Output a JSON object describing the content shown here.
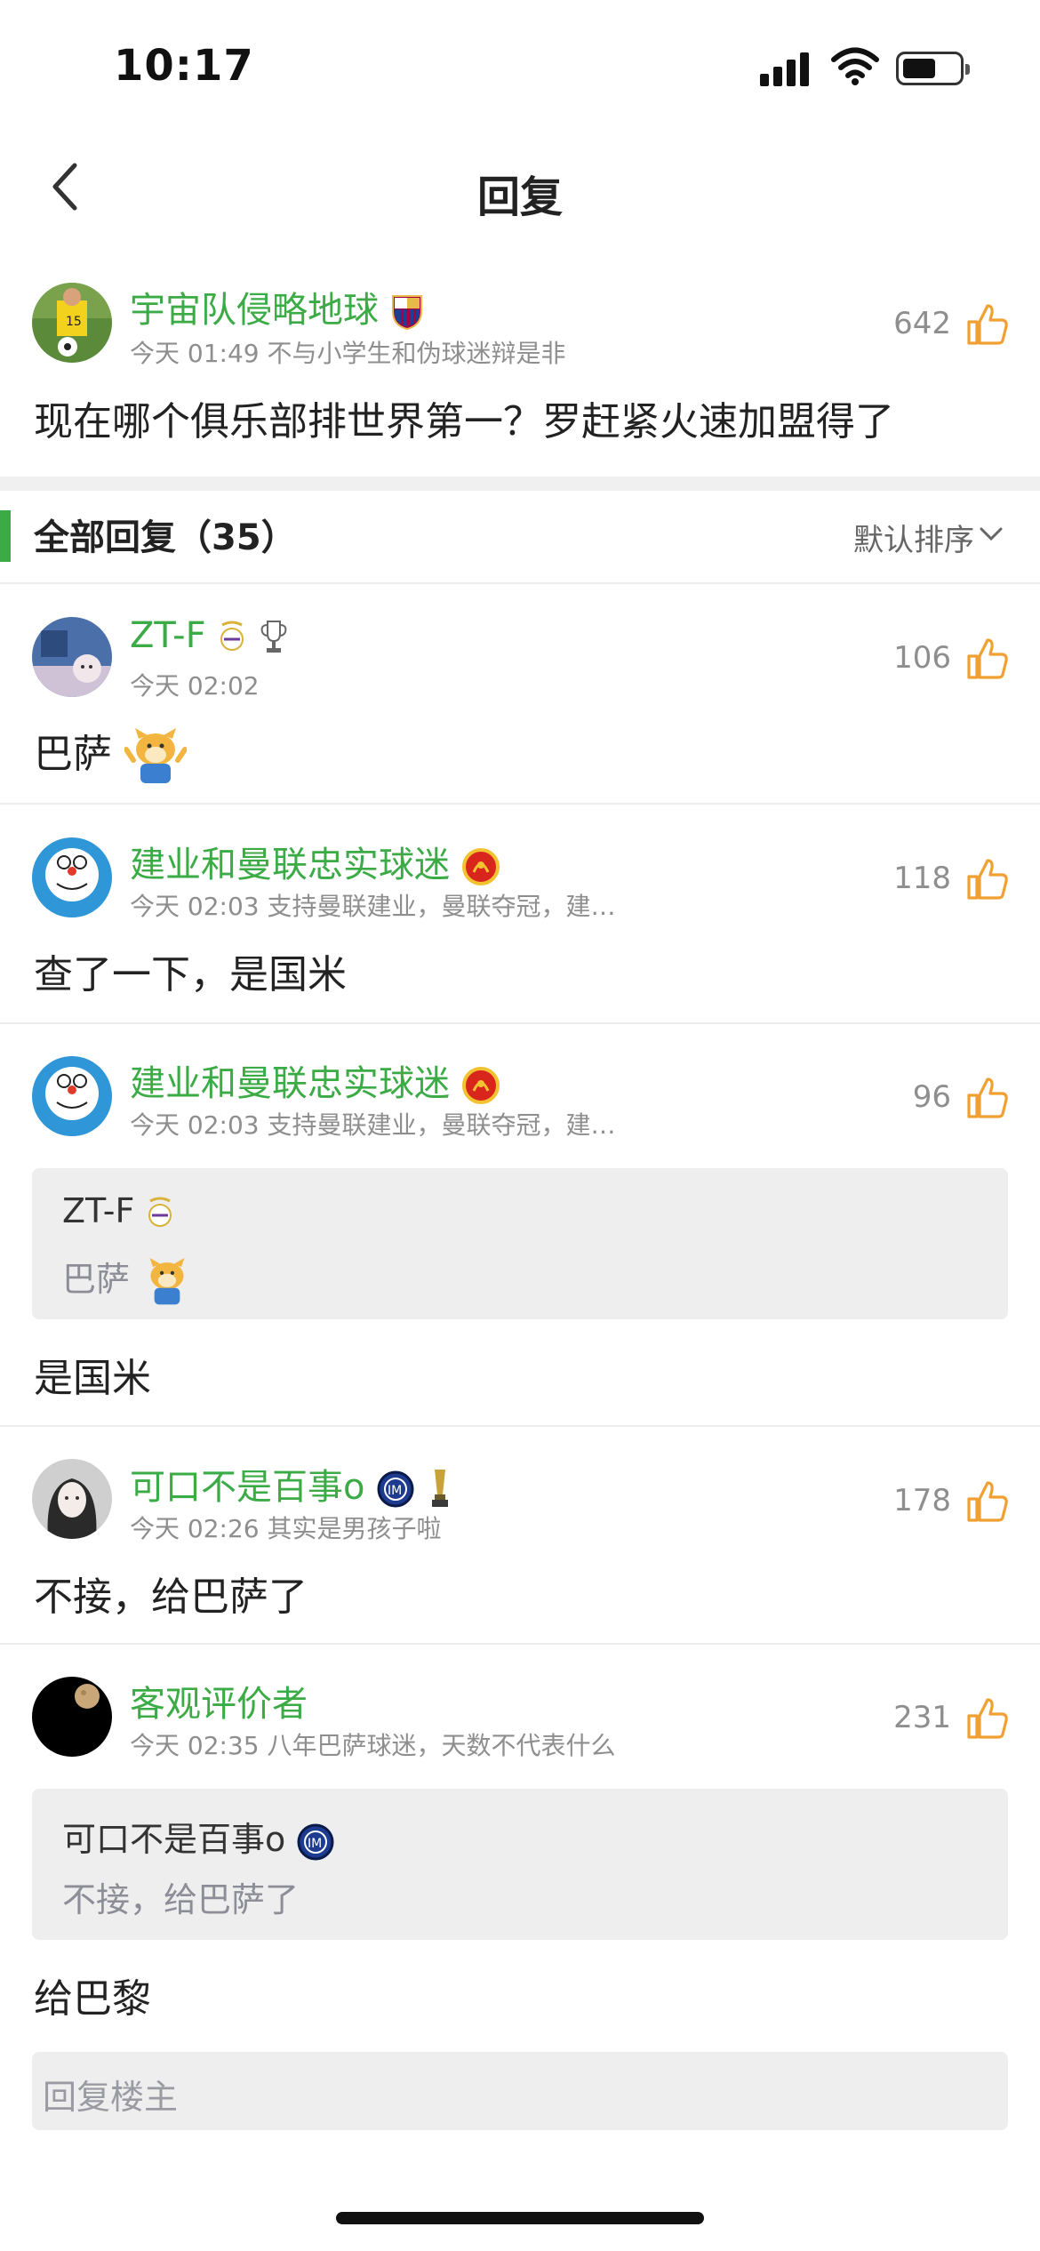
{
  "status": {
    "time": "10:17"
  },
  "nav": {
    "title": "回复",
    "back_icon": "chevron-left-icon"
  },
  "main_post": {
    "username": "宇宙队侵略地球",
    "meta": "今天 01:49 不与小学生和伪球迷辩是非",
    "likes": "642",
    "text": "现在哪个俱乐部排世界第一？罗赶紧火速加盟得了"
  },
  "section": {
    "title": "全部回复（35）",
    "sort_label": "默认排序"
  },
  "replies": [
    {
      "username": "ZT-F",
      "meta": "今天 02:02",
      "likes": "106",
      "text": "巴萨"
    },
    {
      "username": "建业和曼联忠实球迷",
      "meta": "今天 02:03 支持曼联建业，曼联夺冠，建…",
      "likes": "118",
      "text": "查了一下，是国米"
    },
    {
      "username": "建业和曼联忠实球迷",
      "meta": "今天 02:03 支持曼联建业，曼联夺冠，建…",
      "likes": "96",
      "quote_user": "ZT-F",
      "quote_text": "巴萨",
      "text": "是国米"
    },
    {
      "username": "可口不是百事o",
      "meta": "今天 02:26 其实是男孩子啦",
      "likes": "178",
      "text": "不接，给巴萨了"
    },
    {
      "username": "客观评价者",
      "meta": "今天 02:35 八年巴萨球迷，天数不代表什么",
      "likes": "231",
      "quote_user": "可口不是百事o",
      "quote_text": "不接，给巴萨了",
      "text": "给巴黎"
    }
  ],
  "reply_box": {
    "placeholder": "回复楼主"
  },
  "colors": {
    "accent_green": "#3bab45",
    "like_orange": "#f0a030"
  }
}
